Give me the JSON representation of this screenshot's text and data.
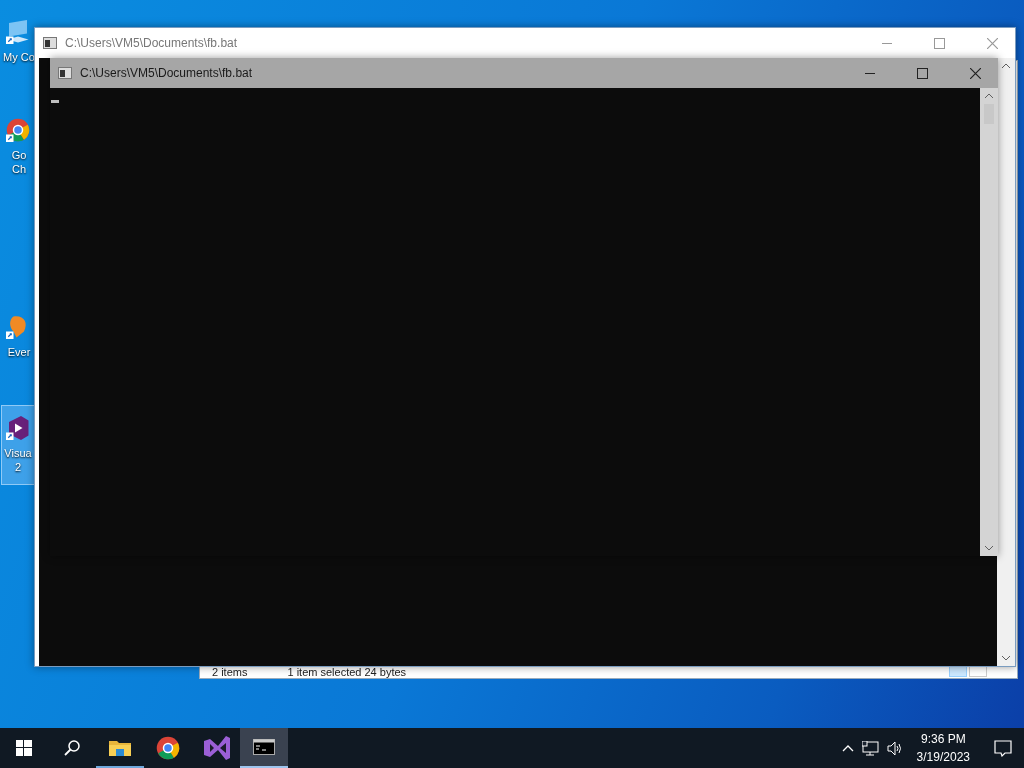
{
  "desktop_icons": [
    {
      "kind": "computer",
      "lines": [
        "My Co"
      ],
      "selected": false
    },
    {
      "kind": "browser",
      "lines": [
        "Go",
        "Ch"
      ],
      "selected": false
    },
    {
      "kind": "notes",
      "lines": [
        "Ever"
      ],
      "selected": false
    },
    {
      "kind": "ide",
      "lines": [
        "Visua",
        "2"
      ],
      "selected": true
    }
  ],
  "explorer": {
    "status_items": "2 items",
    "status_selection": "1 item selected  24 bytes"
  },
  "windows": [
    {
      "title": "C:\\Users\\VM5\\Documents\\fb.bat",
      "active": false
    },
    {
      "title": "C:\\Users\\VM5\\Documents\\fb.bat",
      "active": true
    }
  ],
  "taskbar": {
    "items": [
      {
        "kind": "start",
        "running": false,
        "active": false
      },
      {
        "kind": "search",
        "running": false,
        "active": false
      },
      {
        "kind": "files",
        "running": true,
        "active": false
      },
      {
        "kind": "browser",
        "running": false,
        "active": false
      },
      {
        "kind": "ide",
        "running": false,
        "active": false
      },
      {
        "kind": "console",
        "running": true,
        "active": true
      }
    ],
    "time": "9:36 PM",
    "date": "3/19/2023"
  }
}
